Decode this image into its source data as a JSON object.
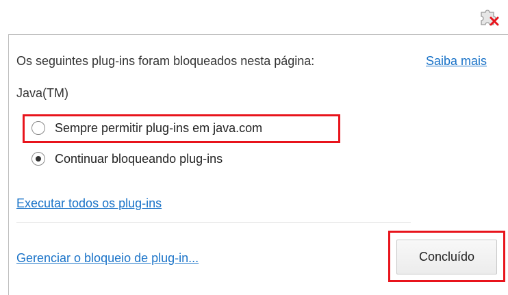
{
  "toolbar": {
    "plugin_blocked_icon": "blocked-puzzle-plugin-icon",
    "accent_color": "#e8141c"
  },
  "bubble": {
    "message": "Os seguintes plug-ins foram bloqueados nesta página:",
    "learn_more": "Saiba mais",
    "plugin_name": "Java(TM)",
    "options": [
      {
        "label": "Sempre permitir plug-ins em java.com",
        "selected": false
      },
      {
        "label": "Continuar bloqueando plug-ins",
        "selected": true
      }
    ],
    "run_all_link": "Executar todos os plug-ins",
    "manage_link": "Gerenciar o bloqueio de plug-in...",
    "done_button": "Concluído",
    "link_color": "#1a73c8",
    "highlight_color": "#e8141c"
  }
}
